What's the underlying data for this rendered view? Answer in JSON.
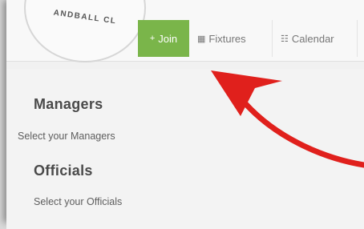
{
  "logo": {
    "text": "ANDBALL CL"
  },
  "nav": {
    "join": {
      "icon": "plus-icon",
      "glyph": "+",
      "label": "Join",
      "color": "#7ab54a"
    },
    "fixtures": {
      "icon": "list-icon",
      "glyph": "▦",
      "label": "Fixtures"
    },
    "calendar": {
      "icon": "list-lines-icon",
      "glyph": "☷",
      "label": "Calendar"
    }
  },
  "sections": {
    "managers": {
      "title": "Managers",
      "subtitle": "Select your Managers"
    },
    "officials": {
      "title": "Officials",
      "subtitle": "Select your Officials"
    }
  },
  "annotation": {
    "icon": "red-arrow-icon",
    "color": "#e0201c"
  }
}
